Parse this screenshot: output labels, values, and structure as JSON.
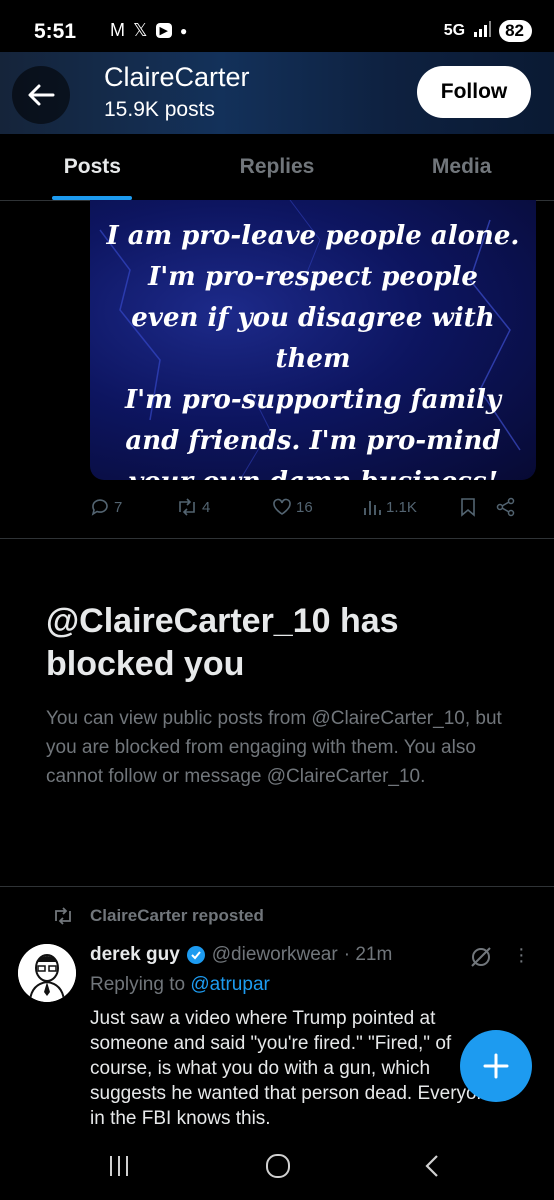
{
  "status_bar": {
    "time": "5:51",
    "network": "5G",
    "battery": "82"
  },
  "header": {
    "title": "ClaireCarter",
    "posts_count": "15.9K posts",
    "follow_label": "Follow"
  },
  "tabs": [
    {
      "label": "Posts",
      "active": true
    },
    {
      "label": "Replies",
      "active": false
    },
    {
      "label": "Media",
      "active": false
    }
  ],
  "post_image": {
    "text": "I am pro-leave people alone.\nI'm pro-respect people\neven if you disagree with them\nI'm pro-supporting family\nand friends. I'm pro-mind\nyour own damn business!"
  },
  "post_actions": {
    "replies": "7",
    "reposts": "4",
    "likes": "16",
    "views": "1.1K"
  },
  "blocked": {
    "title": "@ClaireCarter_10 has blocked you",
    "body": "You can view public posts from @ClaireCarter_10, but you are blocked from engaging with them. You also cannot follow or message @ClaireCarter_10."
  },
  "repost": {
    "label": "ClaireCarter reposted",
    "author_name": "derek guy",
    "author_handle": "@dieworkwear",
    "time": "· 21m",
    "replying_prefix": "Replying to ",
    "replying_to": "@atrupar",
    "text": "Just saw a video where Trump pointed at someone and said \"you're fired.\" \"Fired,\" of course, is what you do with a gun, which suggests he wanted that person dead. Everyone in the FBI knows this."
  },
  "colors": {
    "accent": "#1d9bf0",
    "muted": "#71767b",
    "background": "#000000"
  }
}
